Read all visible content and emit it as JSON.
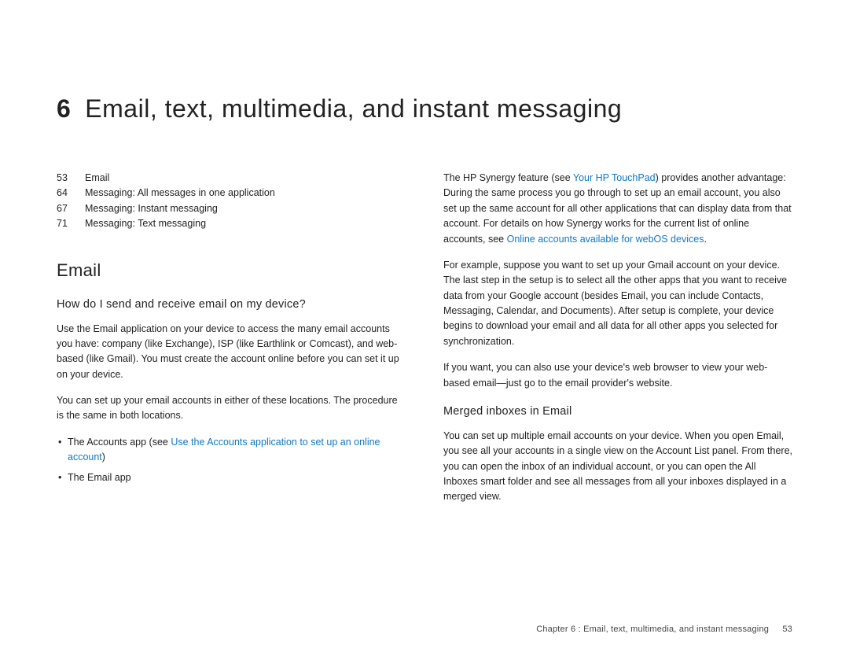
{
  "chapter": {
    "number": "6",
    "title": "Email, text, multimedia, and instant messaging"
  },
  "toc": [
    {
      "page": "53",
      "label": "Email"
    },
    {
      "page": "64",
      "label": "Messaging: All messages in one application"
    },
    {
      "page": "67",
      "label": "Messaging: Instant messaging"
    },
    {
      "page": "71",
      "label": "Messaging: Text messaging"
    }
  ],
  "left": {
    "h2": "Email",
    "h3": "How do I send and receive email on my device?",
    "p1": "Use the Email application on your device to access the many email accounts you have: company (like Exchange), ISP (like Earthlink or Comcast), and web-based (like Gmail). You must create the account online before you can set it up on your device.",
    "p2": "You can set up your email accounts in either of these locations. The procedure is the same in both locations.",
    "bullet1_pre": "The Accounts app (see ",
    "bullet1_link": "Use the Accounts application to set up an online account",
    "bullet1_post": ")",
    "bullet2": "The Email app"
  },
  "right": {
    "p1_pre": "The HP Synergy feature (see ",
    "p1_link1": "Your HP TouchPad",
    "p1_mid": ") provides another advantage: During the same process you go through to set up an email account, you also set up the same account for all other applications that can display data from that account. For details on how Synergy works for the current list of online accounts, see ",
    "p1_link2": "Online accounts available for webOS devices",
    "p1_post": ".",
    "p2": "For example, suppose you want to set up your Gmail account on your device. The last step in the setup is to select all the other apps that you want to receive data from your Google account (besides Email, you can include Contacts, Messaging, Calendar, and Documents). After setup is complete, your device begins to download your email and all data for all other apps you selected for synchronization.",
    "p3": "If you want, you can also use your device's web browser to view your web-based email—just go to the email provider's website.",
    "h3": "Merged inboxes in Email",
    "p4": "You can set up multiple email accounts on your device. When you open Email, you see all your accounts in a single view on the Account List panel. From there, you can open the inbox of an individual account, or you can open the All Inboxes smart folder and see all messages from all your inboxes displayed in a merged view."
  },
  "footer": {
    "text": "Chapter 6  :  Email, text, multimedia, and instant messaging",
    "page": "53"
  }
}
